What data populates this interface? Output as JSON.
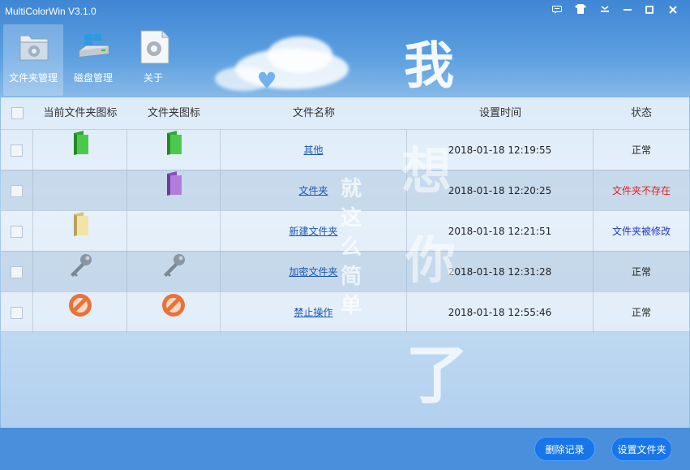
{
  "window": {
    "title": "MultiColorWin V3.1.0",
    "controls": [
      "feedback",
      "skin",
      "menu",
      "minimize",
      "maximize",
      "close"
    ]
  },
  "toolbar": {
    "items": [
      {
        "label": "文件夹管理",
        "icon": "folder-settings-icon",
        "active": true
      },
      {
        "label": "磁盘管理",
        "icon": "disk-icon",
        "active": false
      },
      {
        "label": "关于",
        "icon": "about-gear-icon",
        "active": false
      }
    ]
  },
  "watermark": {
    "chars": [
      "我",
      "想",
      "你",
      "了"
    ],
    "small": "就这么简单"
  },
  "table": {
    "headers": {
      "current_icon": "当前文件夹图标",
      "folder_icon": "文件夹图标",
      "name": "文件名称",
      "time": "设置时间",
      "status": "状态"
    },
    "rows": [
      {
        "current_icon": "green-folder-icon",
        "folder_icon": "green-folder-icon",
        "name": "其他",
        "time": "2018-01-18 12:19:55",
        "status": "正常",
        "status_type": "ok"
      },
      {
        "current_icon": "",
        "folder_icon": "purple-folder-icon",
        "name": "文件夹",
        "time": "2018-01-18 12:20:25",
        "status": "文件夹不存在",
        "status_type": "missing"
      },
      {
        "current_icon": "yellow-folder-icon",
        "folder_icon": "",
        "name": "新建文件夹",
        "time": "2018-01-18 12:21:51",
        "status": "文件夹被修改",
        "status_type": "modified"
      },
      {
        "current_icon": "key-icon",
        "folder_icon": "key-icon",
        "name": "加密文件夹",
        "time": "2018-01-18 12:31:28",
        "status": "正常",
        "status_type": "ok"
      },
      {
        "current_icon": "forbidden-icon",
        "folder_icon": "forbidden-icon",
        "name": "禁止操作",
        "time": "2018-01-18 12:55:46",
        "status": "正常",
        "status_type": "ok"
      }
    ]
  },
  "footer": {
    "delete_label": "删除记录",
    "set_label": "设置文件夹"
  },
  "colors": {
    "status_missing": "#e02020",
    "status_modified": "#1e36c8",
    "button": "#1976e8",
    "link": "#1b57b0"
  }
}
